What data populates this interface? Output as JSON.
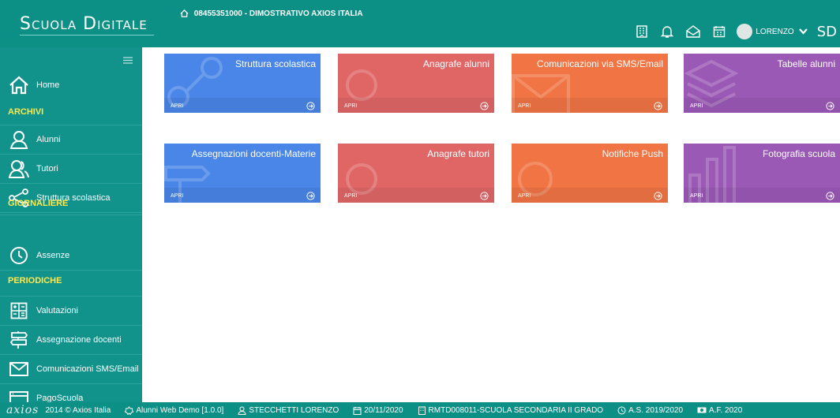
{
  "header": {
    "brand": "Scuola Digitale",
    "school": "08455351000 - DIMOSTRATIVO AXIOS ITALIA",
    "user_name": "LORENZO",
    "sd_logo": "SD",
    "icons": [
      "building-icon",
      "bell-icon",
      "mail-open-icon",
      "calendar-icon",
      "avatar",
      "chevron-down-icon"
    ]
  },
  "sidebar": {
    "home": "Home",
    "sections": [
      {
        "label": "ARCHIVI"
      },
      {
        "label": "GIORNALIERE"
      },
      {
        "label": "PERIODICHE"
      }
    ],
    "items": [
      {
        "label": "Alunni",
        "icon": "user-icon"
      },
      {
        "label": "Tutori",
        "icon": "users-icon"
      },
      {
        "label": "Struttura scolastica",
        "icon": "share-icon"
      },
      {
        "label": "Assenze",
        "icon": "clock-icon"
      },
      {
        "label": "Valutazioni",
        "icon": "calculator-icon"
      },
      {
        "label": "Assegnazione docenti",
        "icon": "signpost-icon"
      },
      {
        "label": "Comunicazioni SMS/Email",
        "icon": "envelope-icon"
      },
      {
        "label": "PagoScuola",
        "icon": "window-icon"
      }
    ]
  },
  "tiles": [
    {
      "title": "Struttura scolastica",
      "apri": "APRI",
      "color": "#4a86e8"
    },
    {
      "title": "Anagrafe alunni",
      "apri": "APRI",
      "color": "#e06666"
    },
    {
      "title": "Comunicazioni via SMS/Email",
      "apri": "APRI",
      "color": "#f07444"
    },
    {
      "title": "Tabelle alunni",
      "apri": "APRI",
      "color": "#9b59b6"
    },
    {
      "title": "Assegnazioni docenti-Materie",
      "apri": "APRI",
      "color": "#4a86e8"
    },
    {
      "title": "Anagrafe tutori",
      "apri": "APRI",
      "color": "#e06666"
    },
    {
      "title": "Notifiche Push",
      "apri": "APRI",
      "color": "#f07444"
    },
    {
      "title": "Fotografia scuola",
      "apri": "APRI",
      "color": "#9b59b6"
    }
  ],
  "footer": {
    "logo": "axios",
    "copyright": "2014 © Axios Italia",
    "app": "Alunni Web Demo [1.0.0]",
    "user": "STECCHETTI LORENZO",
    "date": "20/11/2020",
    "school": "RMTD008011-SCUOLA SECONDARIA II GRADO",
    "as": "A.S. 2019/2020",
    "af": "A.F. 2020"
  }
}
